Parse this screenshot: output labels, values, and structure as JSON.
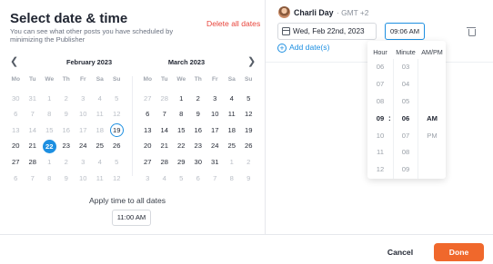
{
  "left": {
    "title": "Select date & time",
    "subtitle": "You can see what other posts you have scheduled by minimizing the Publisher",
    "delete_all": "Delete all dates",
    "apply_label": "Apply time to all dates",
    "apply_time": "11:00 AM"
  },
  "calendar": {
    "prev_icon": "chevron-left-icon",
    "next_icon": "chevron-right-icon",
    "weekdays": [
      "Mo",
      "Tu",
      "We",
      "Th",
      "Fr",
      "Sa",
      "Su"
    ],
    "months": [
      {
        "title": "February 2023",
        "days": [
          {
            "d": "30",
            "s": "muted"
          },
          {
            "d": "31",
            "s": "muted"
          },
          {
            "d": "1",
            "s": "muted"
          },
          {
            "d": "2",
            "s": "muted"
          },
          {
            "d": "3",
            "s": "muted"
          },
          {
            "d": "4",
            "s": "muted"
          },
          {
            "d": "5",
            "s": "muted"
          },
          {
            "d": "6",
            "s": "muted"
          },
          {
            "d": "7",
            "s": "muted"
          },
          {
            "d": "8",
            "s": "muted"
          },
          {
            "d": "9",
            "s": "muted"
          },
          {
            "d": "10",
            "s": "muted"
          },
          {
            "d": "11",
            "s": "muted"
          },
          {
            "d": "12",
            "s": "muted"
          },
          {
            "d": "13",
            "s": "muted"
          },
          {
            "d": "14",
            "s": "muted"
          },
          {
            "d": "15",
            "s": "muted"
          },
          {
            "d": "16",
            "s": "muted"
          },
          {
            "d": "17",
            "s": "muted"
          },
          {
            "d": "18",
            "s": "muted"
          },
          {
            "d": "19",
            "s": "today"
          },
          {
            "d": "20",
            "s": "active"
          },
          {
            "d": "21",
            "s": "active"
          },
          {
            "d": "22",
            "s": "selected"
          },
          {
            "d": "23",
            "s": "active"
          },
          {
            "d": "24",
            "s": "active"
          },
          {
            "d": "25",
            "s": "active"
          },
          {
            "d": "26",
            "s": "active"
          },
          {
            "d": "27",
            "s": "active"
          },
          {
            "d": "28",
            "s": "active"
          },
          {
            "d": "1",
            "s": "muted"
          },
          {
            "d": "2",
            "s": "muted"
          },
          {
            "d": "3",
            "s": "muted"
          },
          {
            "d": "4",
            "s": "muted"
          },
          {
            "d": "5",
            "s": "muted"
          },
          {
            "d": "6",
            "s": "muted"
          },
          {
            "d": "7",
            "s": "muted"
          },
          {
            "d": "8",
            "s": "muted"
          },
          {
            "d": "9",
            "s": "muted"
          },
          {
            "d": "10",
            "s": "muted"
          },
          {
            "d": "11",
            "s": "muted"
          },
          {
            "d": "12",
            "s": "muted"
          }
        ]
      },
      {
        "title": "March 2023",
        "days": [
          {
            "d": "27",
            "s": "muted"
          },
          {
            "d": "28",
            "s": "muted"
          },
          {
            "d": "1",
            "s": "active"
          },
          {
            "d": "2",
            "s": "active"
          },
          {
            "d": "3",
            "s": "active"
          },
          {
            "d": "4",
            "s": "active"
          },
          {
            "d": "5",
            "s": "active"
          },
          {
            "d": "6",
            "s": "active"
          },
          {
            "d": "7",
            "s": "active"
          },
          {
            "d": "8",
            "s": "active"
          },
          {
            "d": "9",
            "s": "active"
          },
          {
            "d": "10",
            "s": "active"
          },
          {
            "d": "11",
            "s": "active"
          },
          {
            "d": "12",
            "s": "active"
          },
          {
            "d": "13",
            "s": "active"
          },
          {
            "d": "14",
            "s": "active"
          },
          {
            "d": "15",
            "s": "active"
          },
          {
            "d": "16",
            "s": "active"
          },
          {
            "d": "17",
            "s": "active"
          },
          {
            "d": "18",
            "s": "active"
          },
          {
            "d": "19",
            "s": "active"
          },
          {
            "d": "20",
            "s": "active"
          },
          {
            "d": "21",
            "s": "active"
          },
          {
            "d": "22",
            "s": "active"
          },
          {
            "d": "23",
            "s": "active"
          },
          {
            "d": "24",
            "s": "active"
          },
          {
            "d": "25",
            "s": "active"
          },
          {
            "d": "26",
            "s": "active"
          },
          {
            "d": "27",
            "s": "active"
          },
          {
            "d": "28",
            "s": "active"
          },
          {
            "d": "29",
            "s": "active"
          },
          {
            "d": "30",
            "s": "active"
          },
          {
            "d": "31",
            "s": "active"
          },
          {
            "d": "1",
            "s": "muted"
          },
          {
            "d": "2",
            "s": "muted"
          },
          {
            "d": "3",
            "s": "muted"
          },
          {
            "d": "4",
            "s": "muted"
          },
          {
            "d": "5",
            "s": "muted"
          },
          {
            "d": "6",
            "s": "muted"
          },
          {
            "d": "7",
            "s": "muted"
          },
          {
            "d": "8",
            "s": "muted"
          },
          {
            "d": "9",
            "s": "muted"
          }
        ]
      }
    ]
  },
  "right": {
    "profile_name": "Charli Day",
    "profile_tz": "· GMT +2",
    "date_value": "Wed, Feb 22nd, 2023",
    "time_value": "09:06 AM",
    "add_date": "Add date(s)",
    "picker": {
      "headers": [
        "Hour",
        "Minute",
        "AM/PM"
      ],
      "hours": [
        "06",
        "07",
        "08",
        "09",
        "10",
        "11",
        "12"
      ],
      "minutes": [
        "03",
        "04",
        "05",
        "06",
        "07",
        "08",
        "09"
      ],
      "ampm": [
        "",
        "",
        "",
        "AM",
        "PM",
        "",
        ""
      ],
      "colon": ":"
    }
  },
  "footer": {
    "cancel": "Cancel",
    "done": "Done"
  },
  "colors": {
    "accent": "#1d8fe1",
    "done_button": "#f0682c",
    "delete": "#e8453c"
  }
}
